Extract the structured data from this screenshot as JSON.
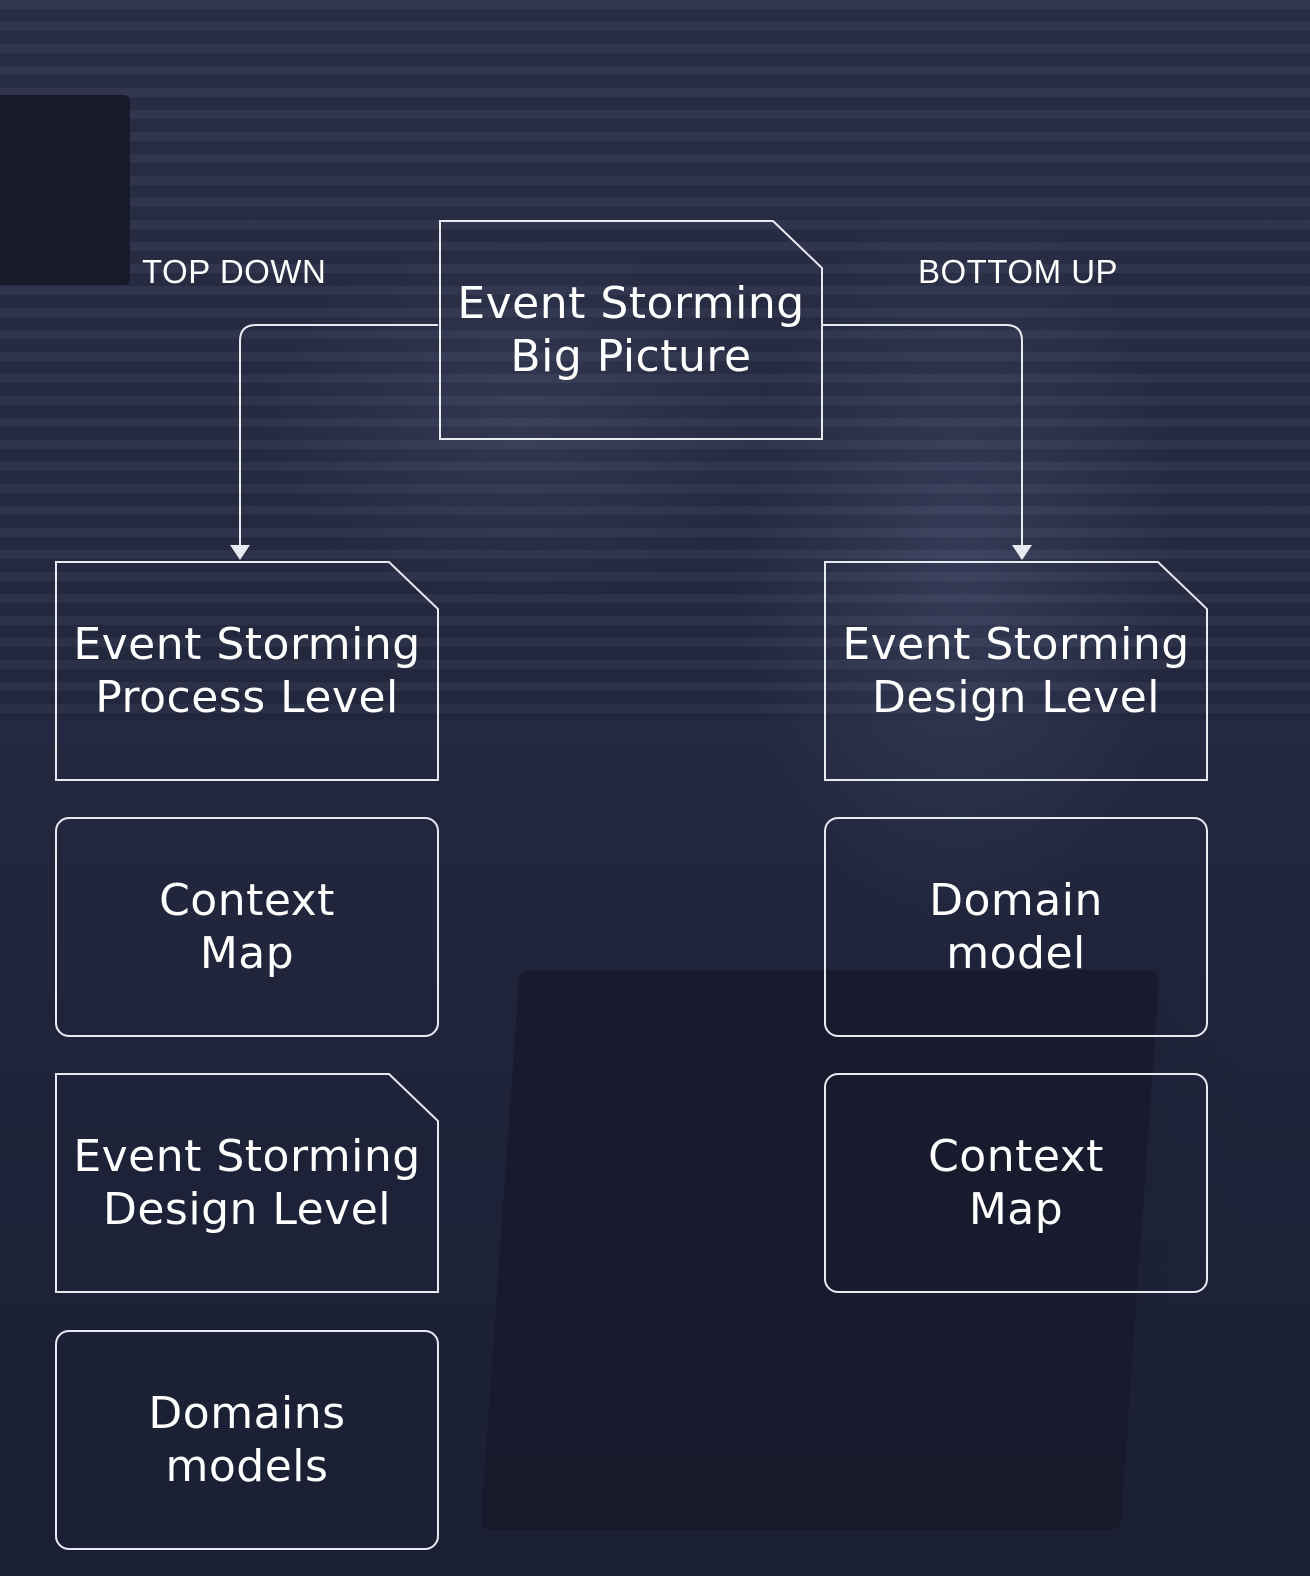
{
  "labels": {
    "top_down": "TOP DOWN",
    "bottom_up": "BOTTOM UP"
  },
  "nodes": {
    "big_picture": [
      "Event Storming",
      "Big Picture"
    ],
    "left": [
      [
        "Event Storming",
        "Process Level"
      ],
      [
        "Context",
        "Map"
      ],
      [
        "Event Storming",
        "Design Level"
      ],
      [
        "Domains",
        "models"
      ]
    ],
    "right": [
      [
        "Event Storming",
        "Design Level"
      ],
      [
        "Domain",
        "model"
      ],
      [
        "Context",
        "Map"
      ]
    ]
  },
  "colors": {
    "line": "#e8eaf2",
    "background": "#242840"
  }
}
